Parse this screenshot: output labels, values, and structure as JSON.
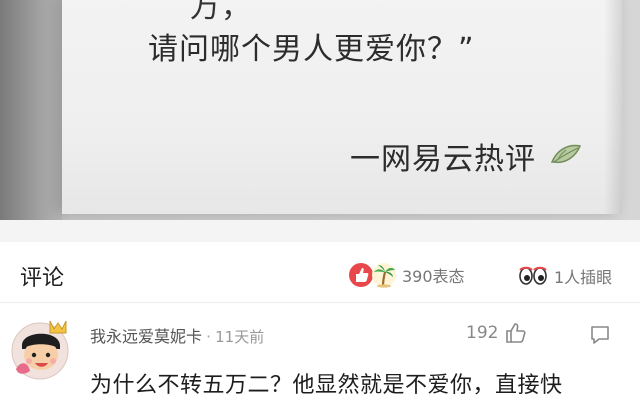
{
  "photo": {
    "quote_top_fragment": "万，",
    "quote_line": "请问哪个男人更爱你？”",
    "signature": "一网易云热评",
    "leaf_icon": "leaf-icon"
  },
  "comments_header": {
    "title": "评论",
    "reactions_count": "390表态",
    "eyes_count": "1人插眼",
    "icons": [
      "thumbs-up-reaction-icon",
      "palm-tree-reaction-icon",
      "eyes-icon"
    ]
  },
  "comment": {
    "username": "我永远爱莫妮卡",
    "separator": "·",
    "time": "11天前",
    "likes": "192",
    "text": "为什么不转五万二？他显然就是不爱你，直接快",
    "icons": [
      "avatar",
      "like-icon",
      "reply-icon"
    ]
  },
  "colors": {
    "reaction_red": "#e8484b",
    "text_dark": "#222222",
    "text_gray": "#888888"
  }
}
